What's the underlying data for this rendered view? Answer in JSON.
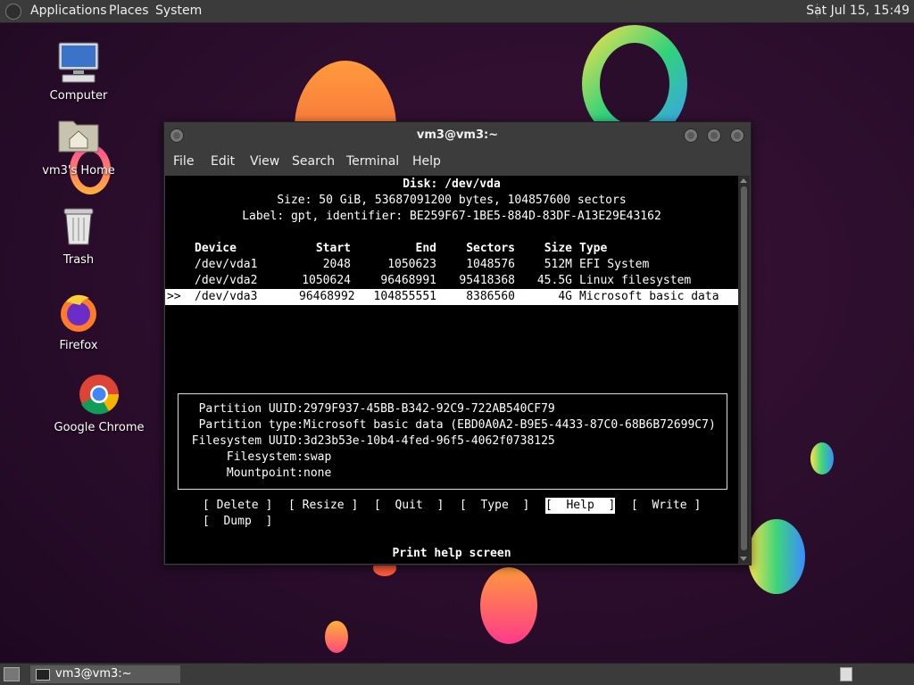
{
  "top_panel": {
    "menus": [
      "Applications",
      "Places",
      "System"
    ],
    "clock": "Sat Jul 15, 15:49"
  },
  "desktop_icons": [
    {
      "label": "Computer",
      "icon": "computer-icon"
    },
    {
      "label": "vm3's Home",
      "icon": "home-folder-icon"
    },
    {
      "label": "Trash",
      "icon": "trash-icon"
    },
    {
      "label": "Firefox",
      "icon": "firefox-icon"
    },
    {
      "label": "Google Chrome",
      "icon": "chrome-icon"
    }
  ],
  "window": {
    "title": "vm3@vm3:~",
    "menu": [
      "File",
      "Edit",
      "View",
      "Search",
      "Terminal",
      "Help"
    ]
  },
  "terminal": {
    "disk_header": "Disk: /dev/vda",
    "size_line": "Size: 50 GiB, 53687091200 bytes, 104857600 sectors",
    "label_line": "Label: gpt, identifier: BE259F67-1BE5-884D-83DF-A13E29E43162",
    "columns": [
      "Device",
      "Start",
      "End",
      "Sectors",
      "Size",
      "Type"
    ],
    "rows": [
      {
        "marker": "",
        "device": "/dev/vda1",
        "start": "2048",
        "end": "1050623",
        "sectors": "1048576",
        "size": "512M",
        "type": "EFI System"
      },
      {
        "marker": "",
        "device": "/dev/vda2",
        "start": "1050624",
        "end": "96468991",
        "sectors": "95418368",
        "size": "45.5G",
        "type": "Linux filesystem"
      },
      {
        "marker": ">>",
        "device": "/dev/vda3",
        "start": "96468992",
        "end": "104855551",
        "sectors": "8386560",
        "size": "4G",
        "type": "Microsoft basic data"
      }
    ],
    "info": {
      "partition_uuid_label": "Partition UUID:",
      "partition_uuid": "2979F937-45BB-B342-92C9-722AB540CF79",
      "partition_type_label": "Partition type:",
      "partition_type": "Microsoft basic data (EBD0A0A2-B9E5-4433-87C0-68B6B72699C7)",
      "filesystem_uuid_label": "Filesystem UUID:",
      "filesystem_uuid": "3d23b53e-10b4-4fed-96f5-4062f0738125",
      "filesystem_label": "Filesystem:",
      "filesystem": "swap",
      "mountpoint_label": "Mountpoint:",
      "mountpoint": "none"
    },
    "buttons": [
      "[ Delete ]",
      "[ Resize ]",
      "[  Quit  ]",
      "[  Type  ]",
      "[  Help  ]",
      "[  Write ]",
      "[  Dump  ]"
    ],
    "active_button": "[  Help  ]",
    "status": "Print help screen"
  },
  "taskbar": {
    "task_label": "vm3@vm3:~"
  }
}
